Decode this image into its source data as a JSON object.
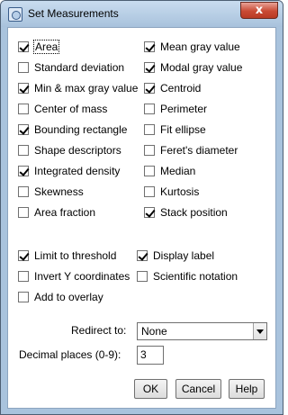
{
  "window": {
    "title": "Set Measurements",
    "close_glyph": "x"
  },
  "measurements": [
    {
      "label": "Area",
      "checked": true,
      "focused": true
    },
    {
      "label": "Standard deviation",
      "checked": false
    },
    {
      "label": "Min & max gray value",
      "checked": true
    },
    {
      "label": "Center of mass",
      "checked": false
    },
    {
      "label": "Bounding rectangle",
      "checked": true
    },
    {
      "label": "Shape descriptors",
      "checked": false
    },
    {
      "label": "Integrated density",
      "checked": true
    },
    {
      "label": "Skewness",
      "checked": false
    },
    {
      "label": "Area fraction",
      "checked": false
    }
  ],
  "measurements_right": [
    {
      "label": "Mean gray value",
      "checked": true
    },
    {
      "label": "Modal gray value",
      "checked": true
    },
    {
      "label": "Centroid",
      "checked": true
    },
    {
      "label": "Perimeter",
      "checked": false
    },
    {
      "label": "Fit ellipse",
      "checked": false
    },
    {
      "label": "Feret's diameter",
      "checked": false
    },
    {
      "label": "Median",
      "checked": false
    },
    {
      "label": "Kurtosis",
      "checked": false
    },
    {
      "label": "Stack position",
      "checked": true
    }
  ],
  "options_left": [
    {
      "label": "Limit to threshold",
      "checked": true
    },
    {
      "label": "Invert Y coordinates",
      "checked": false
    },
    {
      "label": "Add to overlay",
      "checked": false
    }
  ],
  "options_right": [
    {
      "label": "Display label",
      "checked": true
    },
    {
      "label": "Scientific notation",
      "checked": false
    }
  ],
  "redirect": {
    "label": "Redirect to:",
    "value": "None"
  },
  "decimal": {
    "label": "Decimal places (0-9):",
    "value": "3"
  },
  "buttons": {
    "ok": "OK",
    "cancel": "Cancel",
    "help": "Help"
  }
}
